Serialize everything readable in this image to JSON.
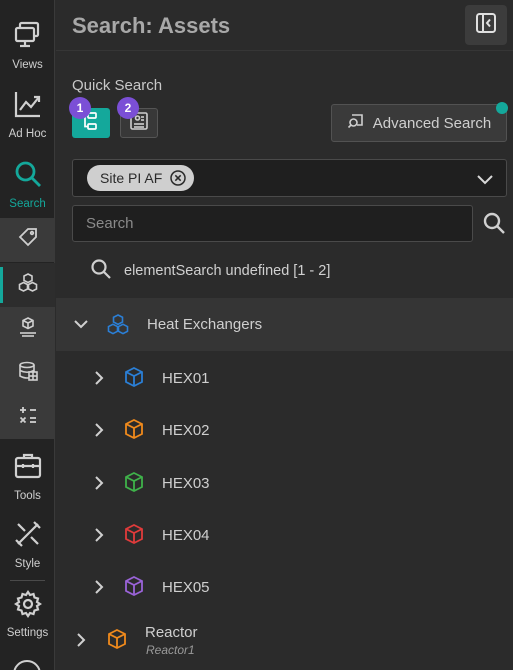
{
  "rail": {
    "items": [
      {
        "label": "Views",
        "icon": "views-icon"
      },
      {
        "label": "Ad Hoc",
        "icon": "chart-line-icon"
      },
      {
        "label": "Search",
        "icon": "search-icon",
        "active": true
      },
      {
        "label": "Tools",
        "icon": "toolbox-icon"
      },
      {
        "label": "Style",
        "icon": "brush-icon"
      },
      {
        "label": "Settings",
        "icon": "gear-icon"
      }
    ],
    "accent": "#14a89b"
  },
  "panel": {
    "title": "Search: Assets",
    "quick_search_label": "Quick Search",
    "badge_one": "1",
    "badge_two": "2",
    "advanced_search_label": "Advanced Search",
    "chip_label": "Site PI AF",
    "search_placeholder": "Search",
    "result_text": "elementSearch undefined [1 - 2]"
  },
  "tree": {
    "group": {
      "label": "Heat Exchangers",
      "color": "#2b7fd6"
    },
    "children": [
      {
        "label": "HEX01",
        "color": "#2b7fd6"
      },
      {
        "label": "HEX02",
        "color": "#f08a1c"
      },
      {
        "label": "HEX03",
        "color": "#3fb24a"
      },
      {
        "label": "HEX04",
        "color": "#e03b3b"
      },
      {
        "label": "HEX05",
        "color": "#9a63d8"
      }
    ],
    "reactor": {
      "label": "Reactor",
      "sublabel": "Reactor1",
      "color": "#f08a1c"
    }
  }
}
